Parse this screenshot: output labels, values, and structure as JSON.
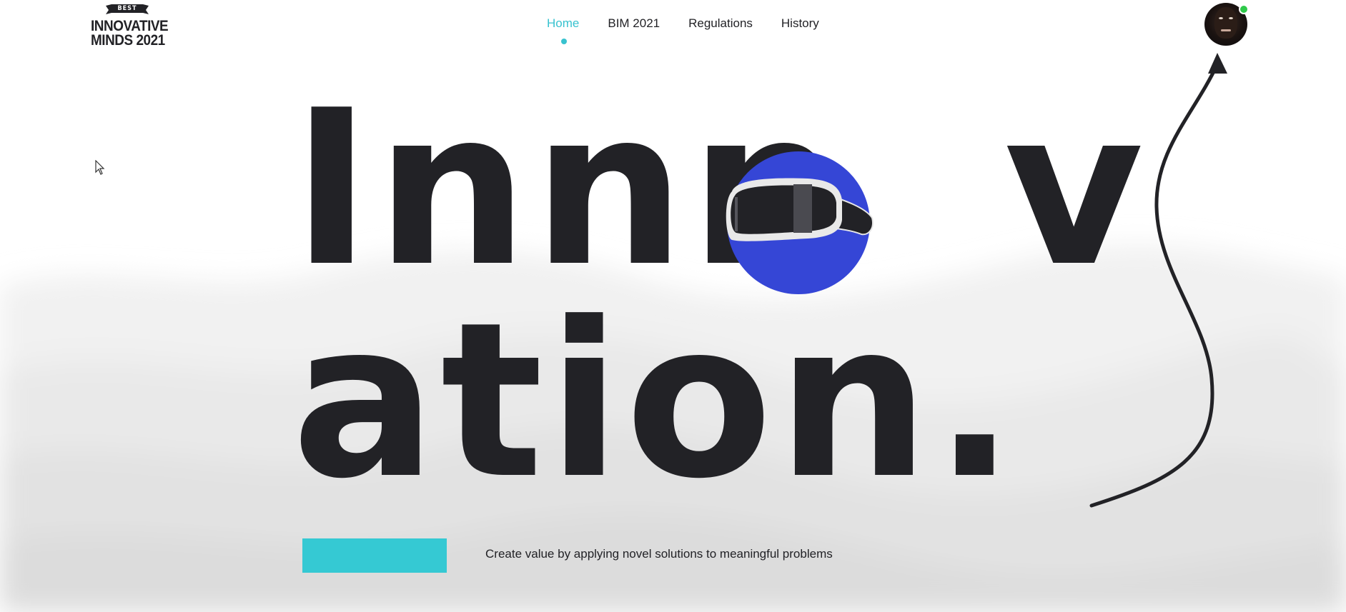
{
  "logo": {
    "badge": "BEST",
    "line1": "INNOVATIVE",
    "line2": "MINDS 2021"
  },
  "nav": {
    "items": [
      {
        "label": "Home",
        "active": true
      },
      {
        "label": "BIM 2021",
        "active": false
      },
      {
        "label": "Regulations",
        "active": false
      },
      {
        "label": "History",
        "active": false
      }
    ]
  },
  "user": {
    "status": "online",
    "status_color": "#2ec94a"
  },
  "hero": {
    "line1_part1": "Inn",
    "line1_n": "n",
    "line1_part2": "v",
    "line2": "ation.",
    "tagline": "Create value by applying novel solutions to meaningful problems",
    "graphic_icon": "vr-headset-icon"
  },
  "colors": {
    "accent": "#35c9d3",
    "nav_active": "#38c2cf",
    "text_dark": "#222226",
    "graphic_circle": "#3546d6"
  }
}
